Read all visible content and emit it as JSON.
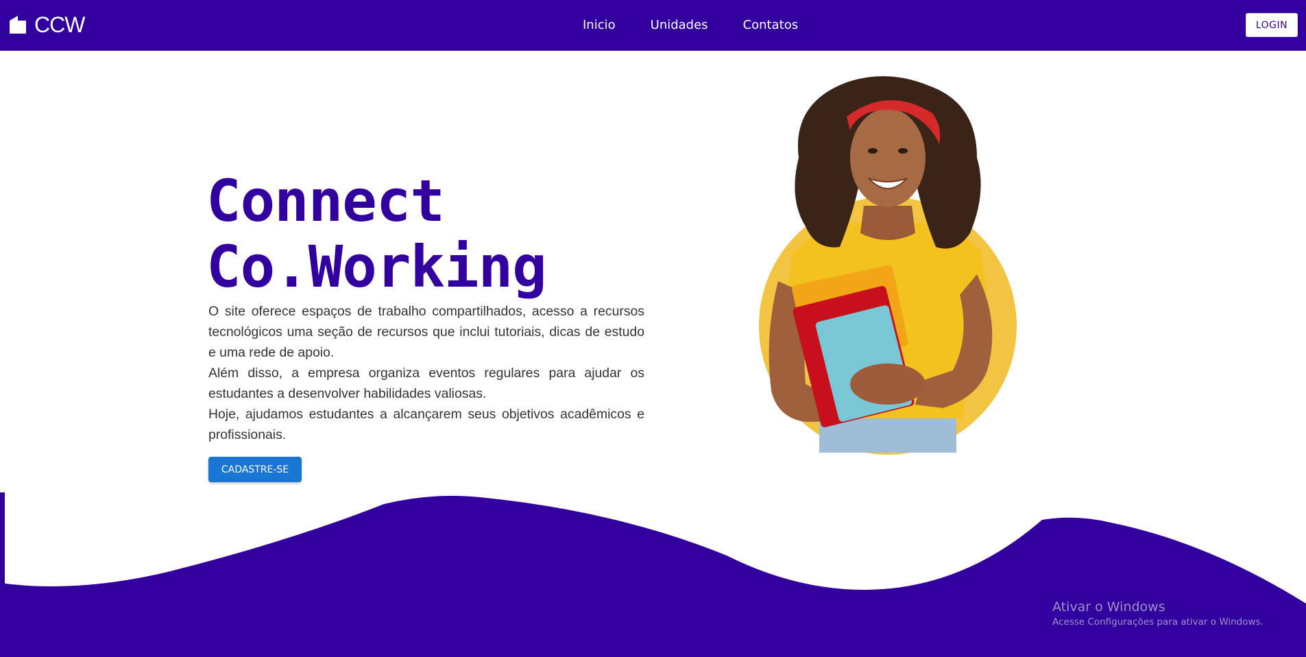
{
  "header": {
    "brand": "CCW",
    "nav": [
      "Inicio",
      "Unidades",
      "Contatos"
    ],
    "login_label": "LOGIN"
  },
  "hero": {
    "title_line1": "Connect",
    "title_line2": "Co.Working",
    "paragraphs": [
      "O site oferece espaços de trabalho compartilhados, acesso a recursos tecnológicos uma seção de recursos que inclui tutoriais, dicas de estudo e uma rede de apoio.",
      "Além disso, a empresa organiza eventos regulares para ajudar os estudantes a desenvolver habilidades valiosas.",
      "Hoje, ajudamos estudantes a alcançarem seus objetivos acadêmicos e profissionais."
    ],
    "cta_label": "CADASTRE-SE"
  },
  "watermark": {
    "line1": "Ativar o Windows",
    "line2": "Acesse Configurações para ativar o Windows."
  },
  "colors": {
    "primary": "#3300a0",
    "cta": "#1976d2",
    "circle": "#f2c442"
  },
  "icons": [
    "building-logo-icon"
  ]
}
